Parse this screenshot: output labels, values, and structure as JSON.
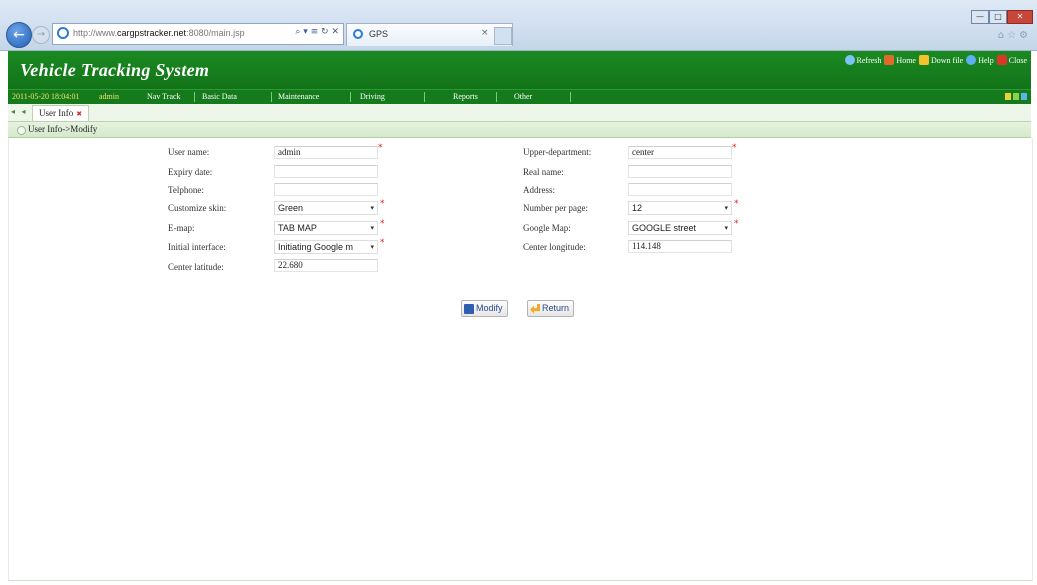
{
  "browser": {
    "address_prefix": "http://www.",
    "address_domain": "cargpstracker.net",
    "address_suffix": ":8080/main.jsp",
    "address_controls": "⌕ ▾ ≡ ↻ ✕",
    "tab_title": "GPS",
    "tab_close": "×"
  },
  "header": {
    "title": "Vehicle Tracking System",
    "actions": [
      {
        "label": "Refresh",
        "icon": "refresh-icon"
      },
      {
        "label": "Home",
        "icon": "home-icon"
      },
      {
        "label": "Down file",
        "icon": "download-icon"
      },
      {
        "label": "Help",
        "icon": "help-icon"
      },
      {
        "label": "Close",
        "icon": "close-icon"
      }
    ]
  },
  "menu": {
    "datetime": "2011-05-20 18:04:01",
    "user": "admin",
    "items": [
      "Nav Track",
      "Basic Data",
      "Maintenance",
      "Driving",
      "Reports",
      "Other"
    ],
    "squares": [
      "#e8d23a",
      "#8dd04a",
      "#5bb4e8"
    ]
  },
  "tabs": {
    "arrows": "◂ ◂",
    "open_tab": "User Info",
    "close": "✖"
  },
  "breadcrumb": "User Info->Modify",
  "form": {
    "left": [
      {
        "label": "User name:",
        "value": "admin",
        "type": "input",
        "required": true
      },
      {
        "label": "Expiry date:",
        "value": "",
        "type": "input",
        "required": false
      },
      {
        "label": "Telphone:",
        "value": "",
        "type": "input",
        "required": false
      },
      {
        "label": "Customize skin:",
        "value": "Green",
        "type": "select",
        "required": true
      },
      {
        "label": "E-map:",
        "value": "TAB MAP",
        "type": "select",
        "required": true
      },
      {
        "label": "Initial interface:",
        "value": "Initiating Google m",
        "type": "select",
        "required": true
      },
      {
        "label": "Center latitude:",
        "value": "22.680",
        "type": "input",
        "required": false
      }
    ],
    "right": [
      {
        "label": "Upper-department:",
        "value": "center",
        "type": "input",
        "required": true
      },
      {
        "label": "Real name:",
        "value": "",
        "type": "input",
        "required": false
      },
      {
        "label": "Address:",
        "value": "",
        "type": "input",
        "required": false
      },
      {
        "label": "Number per page:",
        "value": "12",
        "type": "select",
        "required": true
      },
      {
        "label": "Google Map:",
        "value": "GOOGLE street",
        "type": "select",
        "required": true
      },
      {
        "label": "Center longitude:",
        "value": "114.148",
        "type": "input",
        "required": false
      }
    ],
    "required_mark": "*",
    "dropdown_arrow": "▾",
    "buttons": {
      "modify": "Modify",
      "return": "Return"
    }
  }
}
